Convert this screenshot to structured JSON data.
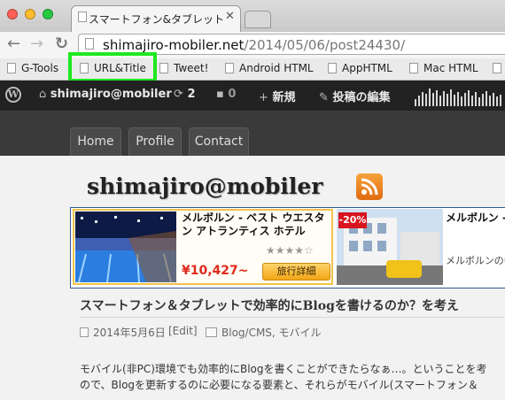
{
  "browser": {
    "tab_title": "スマートフォン&タブレット",
    "tab_close": "✕",
    "url_host": "shimajiro-mobiler.net",
    "url_path": "/2014/05/06/post24430/",
    "traffic_colors": [
      "#ff5f57",
      "#ffbd2e",
      "#28c840"
    ],
    "bookmarks": [
      "G-Tools",
      "URL&Title",
      "Tweet!",
      "Android HTML",
      "AppHTML",
      "Mac HTML"
    ],
    "highlight_color": "#1ee81e"
  },
  "adminbar": {
    "site_name": "shimajiro@mobiler",
    "updates": "2",
    "comments": "0",
    "new_label": "新規",
    "edit_label": "投稿の編集"
  },
  "site": {
    "nav": [
      "Home",
      "Profile",
      "Contact"
    ],
    "title": "shimajiro@mobiler"
  },
  "ad": {
    "item1_name": "メルボルン - ベスト ウエスタン アトランティス ホテル",
    "item1_price": "¥10,427~",
    "item1_button": "旅行詳細",
    "item2_badge": "-20%",
    "item2_name": "メルボルン - テル メルボル",
    "item2_desc": "メルボルンの中 エコフレンドリ"
  },
  "post": {
    "title": "スマートフォン＆タブレットで効率的にBlogを書けるのか？を考え",
    "date": "2014年5月6日",
    "edit": "[Edit]",
    "categories": "Blog/CMS, モバイル",
    "body_line1": "モバイル(非PC)環境でも効率的にBlogを書くことができたらなぁ…。ということを考",
    "body_line2": "ので、Blogを更新するのに必要になる要素と、それらがモバイル(スマートフォン＆"
  }
}
